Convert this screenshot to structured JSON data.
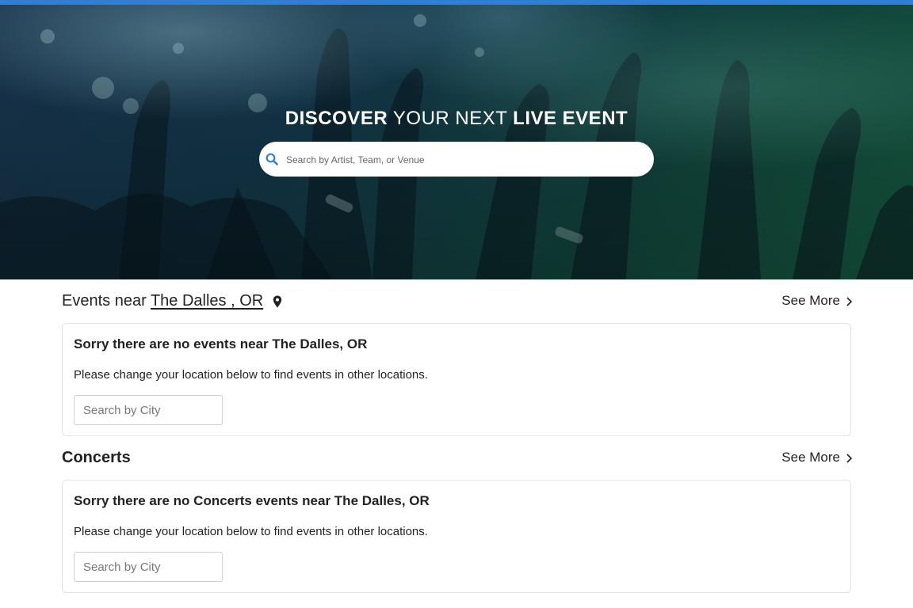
{
  "hero": {
    "title_bold_1": "DISCOVER",
    "title_thin": "YOUR NEXT",
    "title_bold_2": "LIVE EVENT",
    "search_placeholder": "Search by Artist, Team, or Venue"
  },
  "events_section": {
    "prefix": "Events near",
    "location": "The Dalles , OR",
    "see_more": "See More",
    "card": {
      "title": "Sorry there are no events near The Dalles, OR",
      "text": "Please change your location below to find events in other locations.",
      "city_placeholder": "Search by City"
    }
  },
  "concerts_section": {
    "title": "Concerts",
    "see_more": "See More",
    "card": {
      "title": "Sorry there are no Concerts events near The Dalles, OR",
      "text": "Please change your location below to find events in other locations.",
      "city_placeholder": "Search by City"
    }
  },
  "colors": {
    "top_bar": "#2f7fd6",
    "search_icon": "#2f7fd6"
  },
  "icons": {
    "search": "search-icon",
    "location": "map-pin-icon",
    "see_more": "chevron-right-icon"
  }
}
